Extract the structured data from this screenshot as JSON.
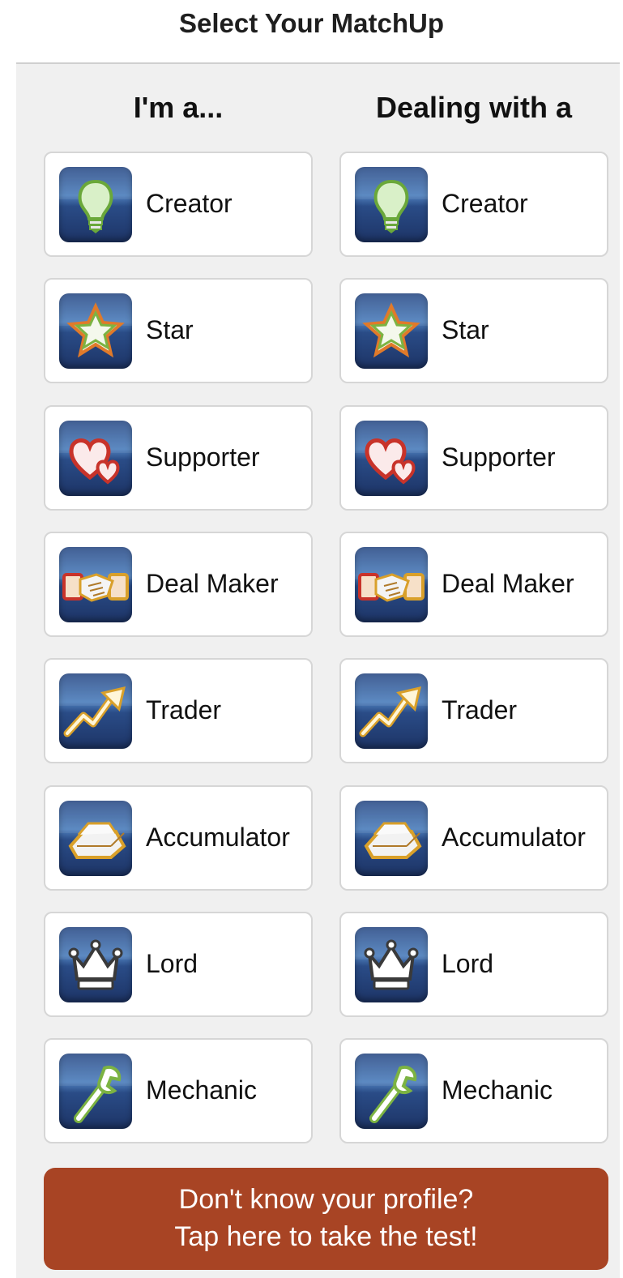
{
  "header": {
    "title": "Select Your MatchUp"
  },
  "columns": {
    "left_heading": "I'm a...",
    "right_heading": "Dealing with a"
  },
  "profiles": [
    {
      "label": "Creator",
      "icon": "lightbulb-icon"
    },
    {
      "label": "Star",
      "icon": "star-icon"
    },
    {
      "label": "Supporter",
      "icon": "hearts-icon"
    },
    {
      "label": "Deal Maker",
      "icon": "handshake-icon"
    },
    {
      "label": "Trader",
      "icon": "trend-arrow-icon"
    },
    {
      "label": "Accumulator",
      "icon": "gold-bars-icon"
    },
    {
      "label": "Lord",
      "icon": "crown-icon"
    },
    {
      "label": "Mechanic",
      "icon": "wrench-icon"
    }
  ],
  "cta": {
    "line1": "Don't know your profile?",
    "line2": "Tap here to take the test!",
    "color": "#a84424"
  },
  "colors": {
    "icon_background": "#3a5f9c",
    "page_background": "#f0f0f0"
  }
}
